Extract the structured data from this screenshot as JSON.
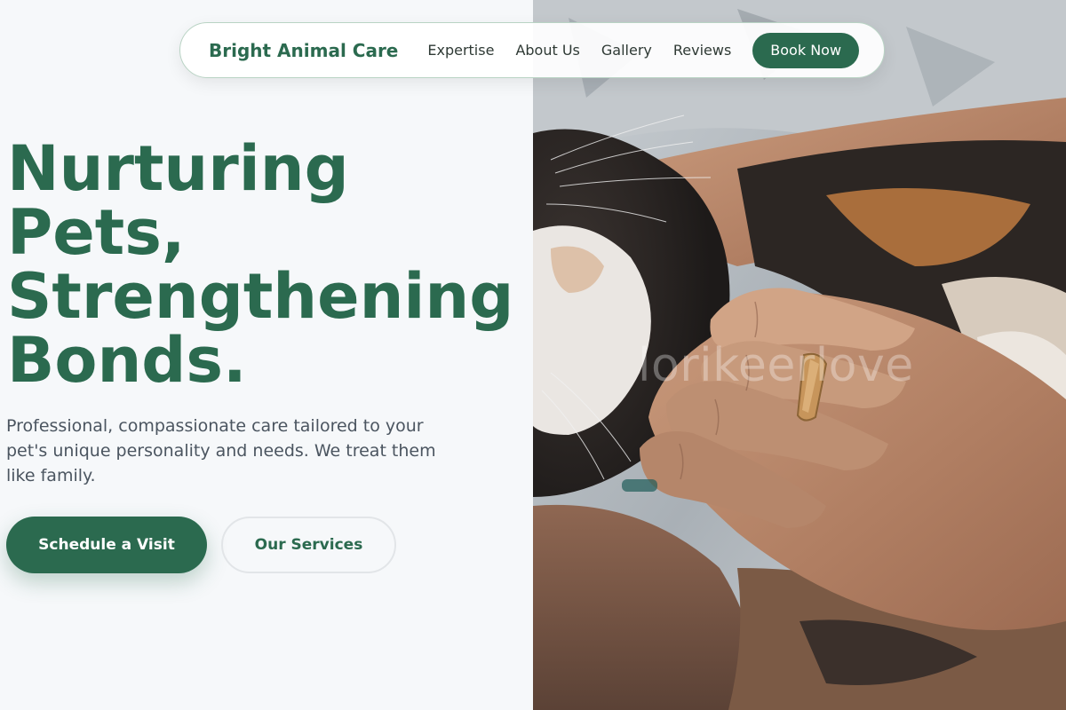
{
  "nav": {
    "brand": "Bright Animal Care",
    "links": [
      "Expertise",
      "About Us",
      "Gallery",
      "Reviews"
    ],
    "cta": "Book Now"
  },
  "hero": {
    "title_lines": [
      "Nurturing",
      "Pets,",
      "Strengthening",
      "Bonds."
    ],
    "description": "Professional, compassionate care tailored to your pet's unique personality and needs. We treat them like family.",
    "primary_button": "Schedule a Visit",
    "secondary_button": "Our Services"
  },
  "image": {
    "description": "Close-up photo of a person's hands with a gold ring petting a calico cat",
    "watermark": "lorikeerlove"
  },
  "colors": {
    "brand_green": "#2b6a4f",
    "page_bg": "#f6f8fa",
    "body_text": "#4b5560"
  }
}
